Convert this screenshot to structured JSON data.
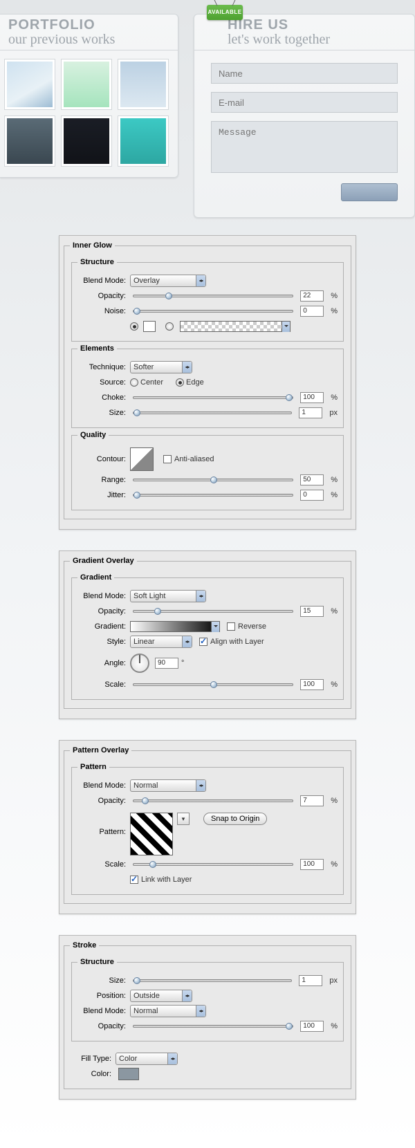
{
  "top": {
    "portfolio": {
      "title": "PORTFOLIO",
      "sub": "our previous works"
    },
    "hire": {
      "badge": "AVAILABLE",
      "title": "HIRE US",
      "sub": "let's work together",
      "name_ph": "Name",
      "email_ph": "E-mail",
      "message_ph": "Message"
    }
  },
  "innerGlow": {
    "legend": "Inner Glow",
    "structure": {
      "legend": "Structure",
      "blendModeLabel": "Blend Mode:",
      "blendMode": "Overlay",
      "opacityLabel": "Opacity:",
      "opacity": "22",
      "opacityUnit": "%",
      "noiseLabel": "Noise:",
      "noise": "0",
      "noiseUnit": "%"
    },
    "elements": {
      "legend": "Elements",
      "techniqueLabel": "Technique:",
      "technique": "Softer",
      "sourceLabel": "Source:",
      "center": "Center",
      "edge": "Edge",
      "chokeLabel": "Choke:",
      "choke": "100",
      "chokeUnit": "%",
      "sizeLabel": "Size:",
      "size": "1",
      "sizeUnit": "px"
    },
    "quality": {
      "legend": "Quality",
      "contourLabel": "Contour:",
      "aa": "Anti-aliased",
      "rangeLabel": "Range:",
      "range": "50",
      "rangeUnit": "%",
      "jitterLabel": "Jitter:",
      "jitter": "0",
      "jitterUnit": "%"
    }
  },
  "gradientOverlay": {
    "legend": "Gradient Overlay",
    "gradient": {
      "legend": "Gradient",
      "blendModeLabel": "Blend Mode:",
      "blendMode": "Soft Light",
      "opacityLabel": "Opacity:",
      "opacity": "15",
      "opacityUnit": "%",
      "gradientLabel": "Gradient:",
      "reverse": "Reverse",
      "styleLabel": "Style:",
      "style": "Linear",
      "align": "Align with Layer",
      "angleLabel": "Angle:",
      "angle": "90",
      "scaleLabel": "Scale:",
      "scale": "100",
      "scaleUnit": "%"
    }
  },
  "patternOverlay": {
    "legend": "Pattern Overlay",
    "pattern": {
      "legend": "Pattern",
      "blendModeLabel": "Blend Mode:",
      "blendMode": "Normal",
      "opacityLabel": "Opacity:",
      "opacity": "7",
      "opacityUnit": "%",
      "patternLabel": "Pattern:",
      "snap": "Snap to Origin",
      "scaleLabel": "Scale:",
      "scale": "100",
      "scaleUnit": "%",
      "link": "Link with Layer"
    }
  },
  "stroke": {
    "legend": "Stroke",
    "structure": {
      "legend": "Structure",
      "sizeLabel": "Size:",
      "size": "1",
      "sizeUnit": "px",
      "positionLabel": "Position:",
      "position": "Outside",
      "blendModeLabel": "Blend Mode:",
      "blendMode": "Normal",
      "opacityLabel": "Opacity:",
      "opacity": "100",
      "opacityUnit": "%"
    },
    "fill": {
      "fillTypeLabel": "Fill Type:",
      "fillType": "Color",
      "colorLabel": "Color:"
    }
  }
}
